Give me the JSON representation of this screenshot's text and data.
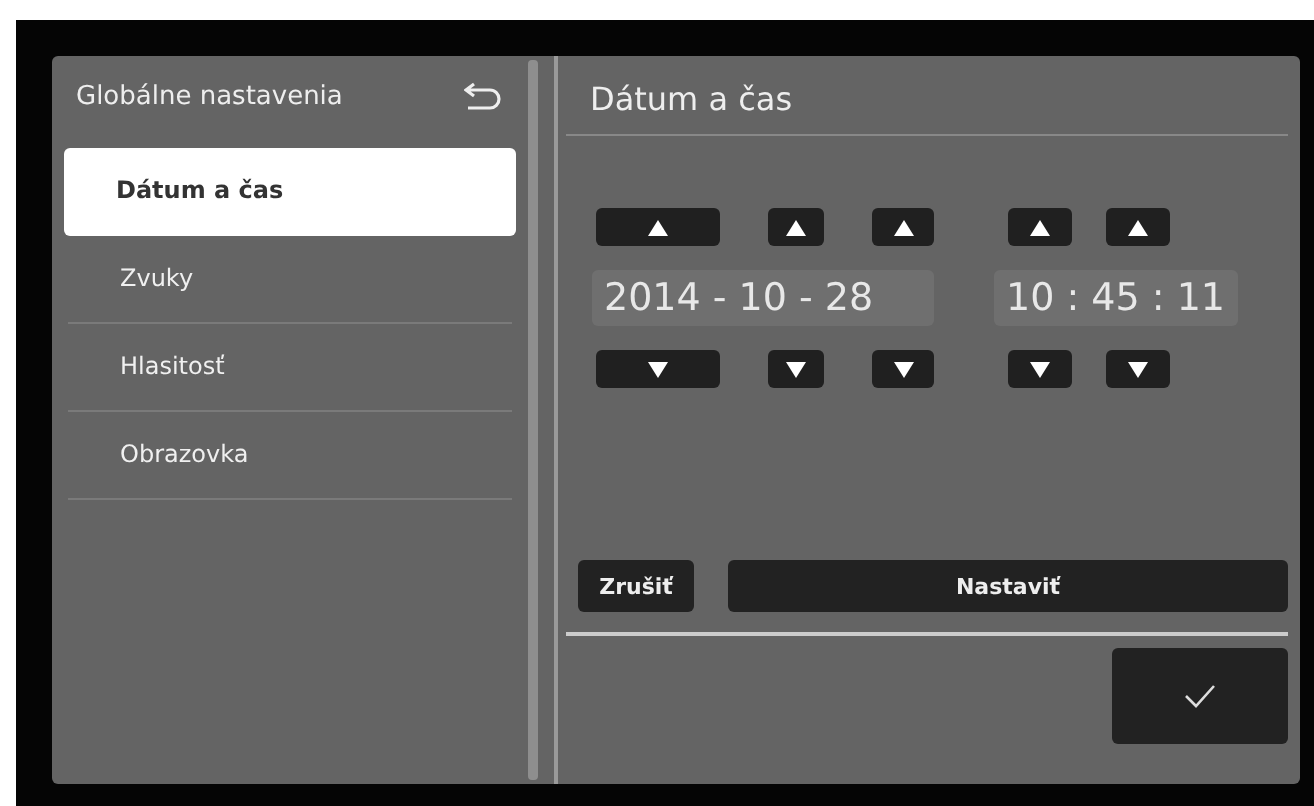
{
  "sidebar": {
    "title": "Globálne nastavenia",
    "items": [
      {
        "label": "Dátum a čas",
        "selected": true
      },
      {
        "label": "Zvuky",
        "selected": false
      },
      {
        "label": "Hlasitosť",
        "selected": false
      },
      {
        "label": "Obrazovka",
        "selected": false
      }
    ]
  },
  "panel": {
    "title": "Dátum a čas",
    "date_value": "2014 - 10 - 28",
    "time_value": "10 : 45 : 11"
  },
  "buttons": {
    "cancel": "Zrušiť",
    "set": "Nastaviť"
  }
}
